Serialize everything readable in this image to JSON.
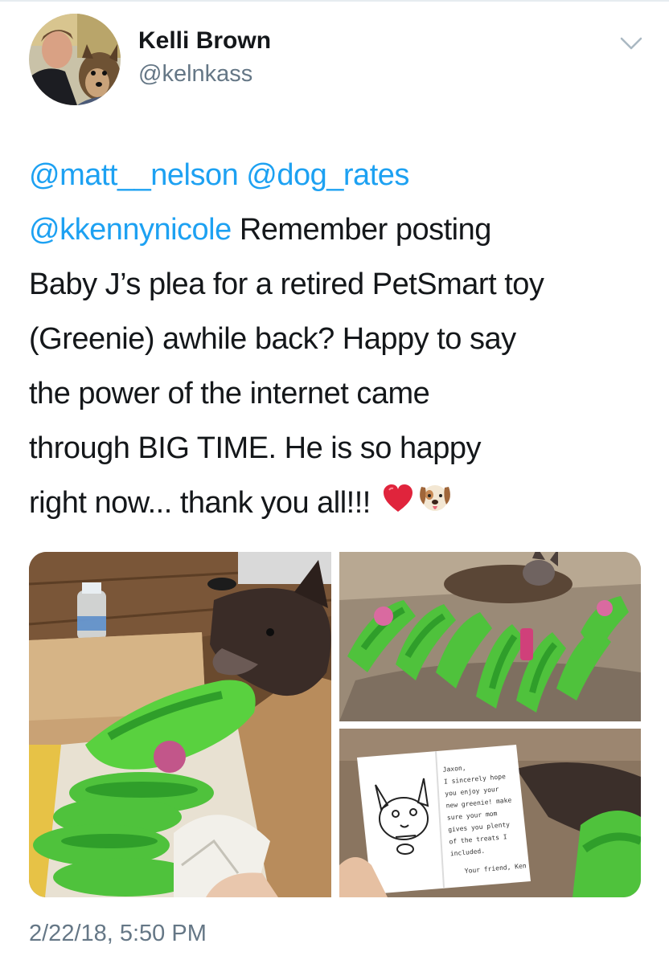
{
  "author": {
    "name": "Kelli Brown",
    "handle": "@kelnkass",
    "avatar_icon": "profile-photo-with-dog"
  },
  "menu": {
    "icon": "chevron-down-icon"
  },
  "tweet": {
    "lines": [
      [
        {
          "text": "@matt__nelson",
          "mention": true
        },
        {
          "text": " ",
          "mention": false
        },
        {
          "text": "@dog_rates",
          "mention": true
        }
      ],
      [
        {
          "text": "@kkennynicole",
          "mention": true
        },
        {
          "text": " Remember posting",
          "mention": false
        }
      ],
      [
        {
          "text": "Baby J’s plea for a retired PetSmart toy",
          "mention": false
        }
      ],
      [
        {
          "text": "(Greenie) awhile back? Happy to say",
          "mention": false
        }
      ],
      [
        {
          "text": "the power of the internet came",
          "mention": false
        }
      ],
      [
        {
          "text": "through BIG TIME. He is so happy",
          "mention": false
        }
      ],
      [
        {
          "text": "right now... thank you all!!!",
          "mention": false
        }
      ]
    ],
    "emojis": [
      "red-heart-icon",
      "dog-face-icon"
    ],
    "mention_color": "#1da1f2"
  },
  "card": {
    "lines": [
      "Jaxon,",
      "I sincerely hope",
      "you enjoy your",
      "new greenie! make",
      "sure your mom",
      "gives you plenty",
      "of the treats I",
      "included.",
      "Your friend, Ken"
    ]
  },
  "timestamp": "2/22/18, 5:50 PM",
  "colors": {
    "text": "#14171a",
    "secondary": "#657786",
    "link": "#1da1f2"
  }
}
